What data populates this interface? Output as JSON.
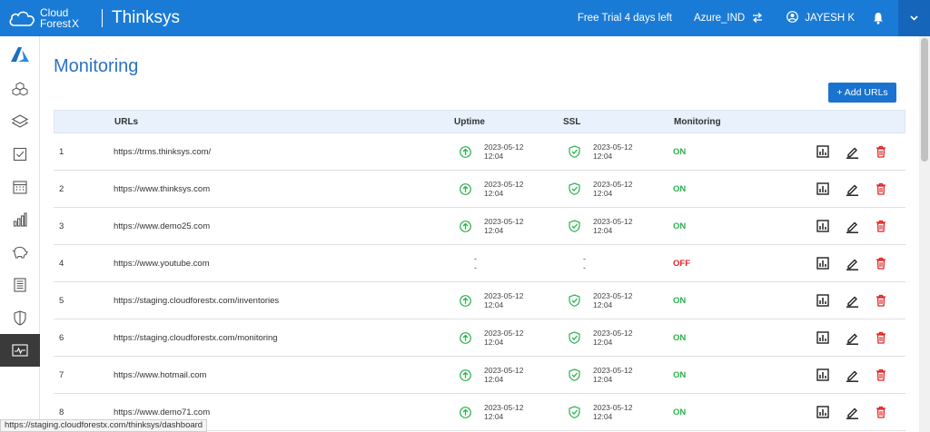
{
  "brand": {
    "logo_line1": "Cloud",
    "logo_line2": "Forest",
    "logo_x": "X",
    "org": "Thinksys"
  },
  "header": {
    "trial": "Free Trial 4 days left",
    "account": "Azure_IND",
    "user": "JAYESH K"
  },
  "sidebar": {
    "items": [
      "azure-logo",
      "inventory",
      "layers",
      "checklist",
      "calendar",
      "analytics",
      "piggy-bank",
      "reports",
      "security",
      "monitoring"
    ]
  },
  "page": {
    "title": "Monitoring",
    "add_button": "+ Add URLs"
  },
  "table": {
    "headers": {
      "urls": "URLs",
      "uptime": "Uptime",
      "ssl": "SSL",
      "monitoring": "Monitoring"
    },
    "rows": [
      {
        "num": "1",
        "url": "https://trms.thinksys.com/",
        "up_date": "2023-05-12",
        "up_time": "12:04",
        "ssl_date": "2023-05-12",
        "ssl_time": "12:04",
        "status": "ON",
        "has_data": true
      },
      {
        "num": "2",
        "url": "https://www.thinksys.com",
        "up_date": "2023-05-12",
        "up_time": "12:04",
        "ssl_date": "2023-05-12",
        "ssl_time": "12:04",
        "status": "ON",
        "has_data": true
      },
      {
        "num": "3",
        "url": "https://www.demo25.com",
        "up_date": "2023-05-12",
        "up_time": "12:04",
        "ssl_date": "2023-05-12",
        "ssl_time": "12:04",
        "status": "ON",
        "has_data": true
      },
      {
        "num": "4",
        "url": "https://www.youtube.com",
        "up_date": "-",
        "up_time": "-",
        "ssl_date": "-",
        "ssl_time": "-",
        "status": "OFF",
        "has_data": false
      },
      {
        "num": "5",
        "url": "https://staging.cloudforestx.com/inventories",
        "up_date": "2023-05-12",
        "up_time": "12:04",
        "ssl_date": "2023-05-12",
        "ssl_time": "12:04",
        "status": "ON",
        "has_data": true
      },
      {
        "num": "6",
        "url": "https://staging.cloudforestx.com/monitoring",
        "up_date": "2023-05-12",
        "up_time": "12:04",
        "ssl_date": "2023-05-12",
        "ssl_time": "12:04",
        "status": "ON",
        "has_data": true
      },
      {
        "num": "7",
        "url": "https://www.hotmail.com",
        "up_date": "2023-05-12",
        "up_time": "12:04",
        "ssl_date": "2023-05-12",
        "ssl_time": "12:04",
        "status": "ON",
        "has_data": true
      },
      {
        "num": "8",
        "url": "https://www.demo71.com",
        "up_date": "2023-05-12",
        "up_time": "12:04",
        "ssl_date": "2023-05-12",
        "ssl_time": "12:04",
        "status": "ON",
        "has_data": true
      }
    ]
  },
  "statusbar": {
    "url": "https://staging.cloudforestx.com/thinksys/dashboard"
  },
  "colors": {
    "primary": "#1a7bd6",
    "on": "#2bb24c",
    "off": "#e02424",
    "title": "#2a73c2"
  }
}
